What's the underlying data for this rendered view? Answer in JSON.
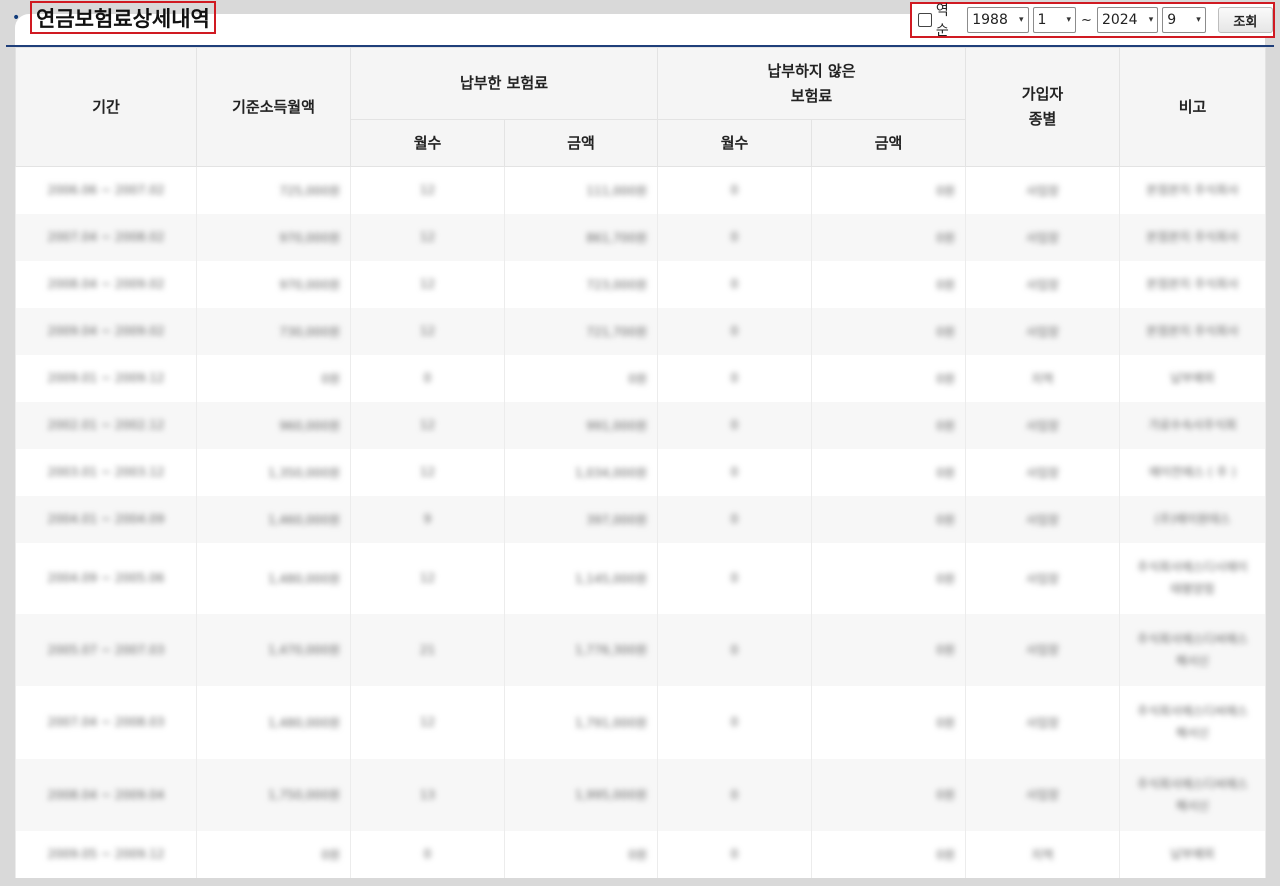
{
  "section": {
    "title": "연금보험료상세내역"
  },
  "filter": {
    "reverse_label": "역순",
    "start_year": "1988",
    "start_month": "1",
    "separator": "~",
    "end_year": "2024",
    "end_month": "9",
    "search_label": "조회"
  },
  "table": {
    "headers": {
      "period": "기간",
      "base_income": "기준소득월액",
      "paid": "납부한 보험료",
      "unpaid_line1": "납부하지 않은",
      "unpaid_line2": "보험료",
      "member_type_line1": "가입자",
      "member_type_line2": "종별",
      "remarks": "비고",
      "months": "월수",
      "amount": "금액"
    },
    "rows": [
      {
        "period": "2006.06 ~ 2007.02",
        "base": "725,000원",
        "paid_months": "12",
        "paid_amount": "111,000원",
        "unpaid_months": "0",
        "unpaid_amount": "0원",
        "type": "사업장",
        "remark": "본점본지 주식회사"
      },
      {
        "period": "2007.04 ~ 2008.02",
        "base": "970,000원",
        "paid_months": "12",
        "paid_amount": "861,700원",
        "unpaid_months": "0",
        "unpaid_amount": "0원",
        "type": "사업장",
        "remark": "본점본지 주식회사"
      },
      {
        "period": "2008.04 ~ 2009.02",
        "base": "970,000원",
        "paid_months": "12",
        "paid_amount": "723,000원",
        "unpaid_months": "0",
        "unpaid_amount": "0원",
        "type": "사업장",
        "remark": "본점본지 주식회사"
      },
      {
        "period": "2009.04 ~ 2009.02",
        "base": "730,000원",
        "paid_months": "12",
        "paid_amount": "721,700원",
        "unpaid_months": "0",
        "unpaid_amount": "0원",
        "type": "사업장",
        "remark": "본점본지 주식회사"
      },
      {
        "period": "2009.01 ~ 2009.12",
        "base": "0원",
        "paid_months": "0",
        "paid_amount": "0원",
        "unpaid_months": "0",
        "unpaid_amount": "0원",
        "type": "지역",
        "remark": "납부예외"
      },
      {
        "period": "2002.01 ~ 2002.12",
        "base": "960,000원",
        "paid_months": "12",
        "paid_amount": "991,000원",
        "unpaid_months": "0",
        "unpaid_amount": "0원",
        "type": "사업장",
        "remark": "가로수속사주식회"
      },
      {
        "period": "2003.01 ~ 2003.12",
        "base": "1,350,000원",
        "paid_months": "12",
        "paid_amount": "1,034,000원",
        "unpaid_months": "0",
        "unpaid_amount": "0원",
        "type": "사업장",
        "remark": "에이전에스 ( 주 )"
      },
      {
        "period": "2004.01 ~ 2004.09",
        "base": "1,460,000원",
        "paid_months": "9",
        "paid_amount": "397,000원",
        "unpaid_months": "0",
        "unpaid_amount": "0원",
        "type": "사업장",
        "remark": "(주)에이원테스"
      },
      {
        "period": "2004.09 ~ 2005.06",
        "base": "1,480,000원",
        "paid_months": "12",
        "paid_amount": "1,145,000원",
        "unpaid_months": "0",
        "unpaid_amount": "0원",
        "type": "사업장",
        "remark": "주식회사에스디시에이 태평양점"
      },
      {
        "period": "2005.07 ~ 2007.03",
        "base": "1,470,000원",
        "paid_months": "21",
        "paid_amount": "1,776,300원",
        "unpaid_months": "0",
        "unpaid_amount": "0원",
        "type": "사업장",
        "remark": "주식회사에스디씨에스 해서신"
      },
      {
        "period": "2007.04 ~ 2008.03",
        "base": "1,480,000원",
        "paid_months": "12",
        "paid_amount": "1,791,000원",
        "unpaid_months": "0",
        "unpaid_amount": "0원",
        "type": "사업장",
        "remark": "주식회사에스디씨에스 해서신"
      },
      {
        "period": "2008.04 ~ 2009.04",
        "base": "1,750,000원",
        "paid_months": "13",
        "paid_amount": "1,995,000원",
        "unpaid_months": "0",
        "unpaid_amount": "0원",
        "type": "사업장",
        "remark": "주식회사에스디씨에스 해서신"
      },
      {
        "period": "2009.05 ~ 2009.12",
        "base": "0원",
        "paid_months": "0",
        "paid_amount": "0원",
        "unpaid_months": "0",
        "unpaid_amount": "0원",
        "type": "지역",
        "remark": "납부예외"
      }
    ]
  }
}
